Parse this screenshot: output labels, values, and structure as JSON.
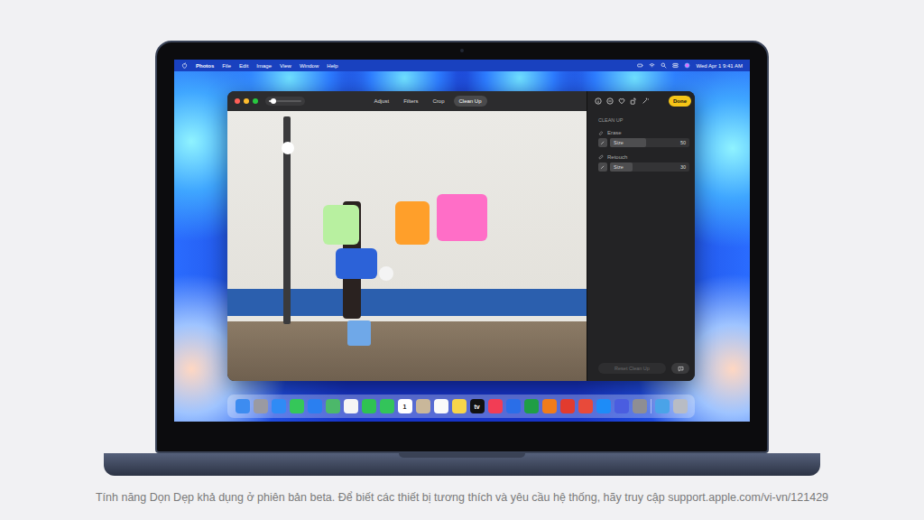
{
  "menubar": {
    "app": "Photos",
    "items": [
      "File",
      "Edit",
      "Image",
      "View",
      "Window",
      "Help"
    ],
    "clock": "Wed Apr 1 9:41 AM"
  },
  "toolbar": {
    "zoom_level": 0.15,
    "tabs": [
      {
        "label": "Adjust",
        "selected": false
      },
      {
        "label": "Filters",
        "selected": false
      },
      {
        "label": "Crop",
        "selected": false
      },
      {
        "label": "Clean Up",
        "selected": true
      }
    ]
  },
  "sidebar": {
    "done": "Done",
    "section": "CLEAN UP",
    "tools": [
      {
        "label": "Erase",
        "size_label": "Size",
        "value": "50",
        "level": 0.45
      },
      {
        "label": "Retouch",
        "size_label": "Size",
        "value": "30",
        "level": 0.28
      }
    ],
    "reset": {
      "label": "Reset Clean Up",
      "disabled": true
    }
  },
  "dock": [
    {
      "color": "#3d8cf0"
    },
    {
      "color": "#9a9aa2"
    },
    {
      "color": "#2f8bf5"
    },
    {
      "color": "#35c759"
    },
    {
      "color": "#2a7ff0"
    },
    {
      "color": "#4cb86a"
    },
    {
      "color": "#f5f5f5"
    },
    {
      "color": "#2fc252"
    },
    {
      "color": "#33c45a"
    },
    {
      "color": "#ffffff",
      "label": "1"
    },
    {
      "color": "#c9b79a"
    },
    {
      "color": "#fafafa"
    },
    {
      "color": "#f7d54a"
    },
    {
      "color": "#111111",
      "label": "tv"
    },
    {
      "color": "#f23d55"
    },
    {
      "color": "#2a6ee8"
    },
    {
      "color": "#1f9e45"
    },
    {
      "color": "#f07c1a"
    },
    {
      "color": "#e23b2e"
    },
    {
      "color": "#e84a3a"
    },
    {
      "color": "#1d8cf8"
    },
    {
      "color": "#4a5de0"
    },
    {
      "color": "#8e8e93"
    },
    {
      "color": "#4aa3e8"
    },
    {
      "color": "#b8bcc4"
    }
  ],
  "caption": "Tính năng Dọn Dẹp khả dụng ở phiên bản beta. Để biết các thiết bị tương thích và yêu cầu hệ thống, hãy truy cập support.apple.com/vi-vn/121429"
}
